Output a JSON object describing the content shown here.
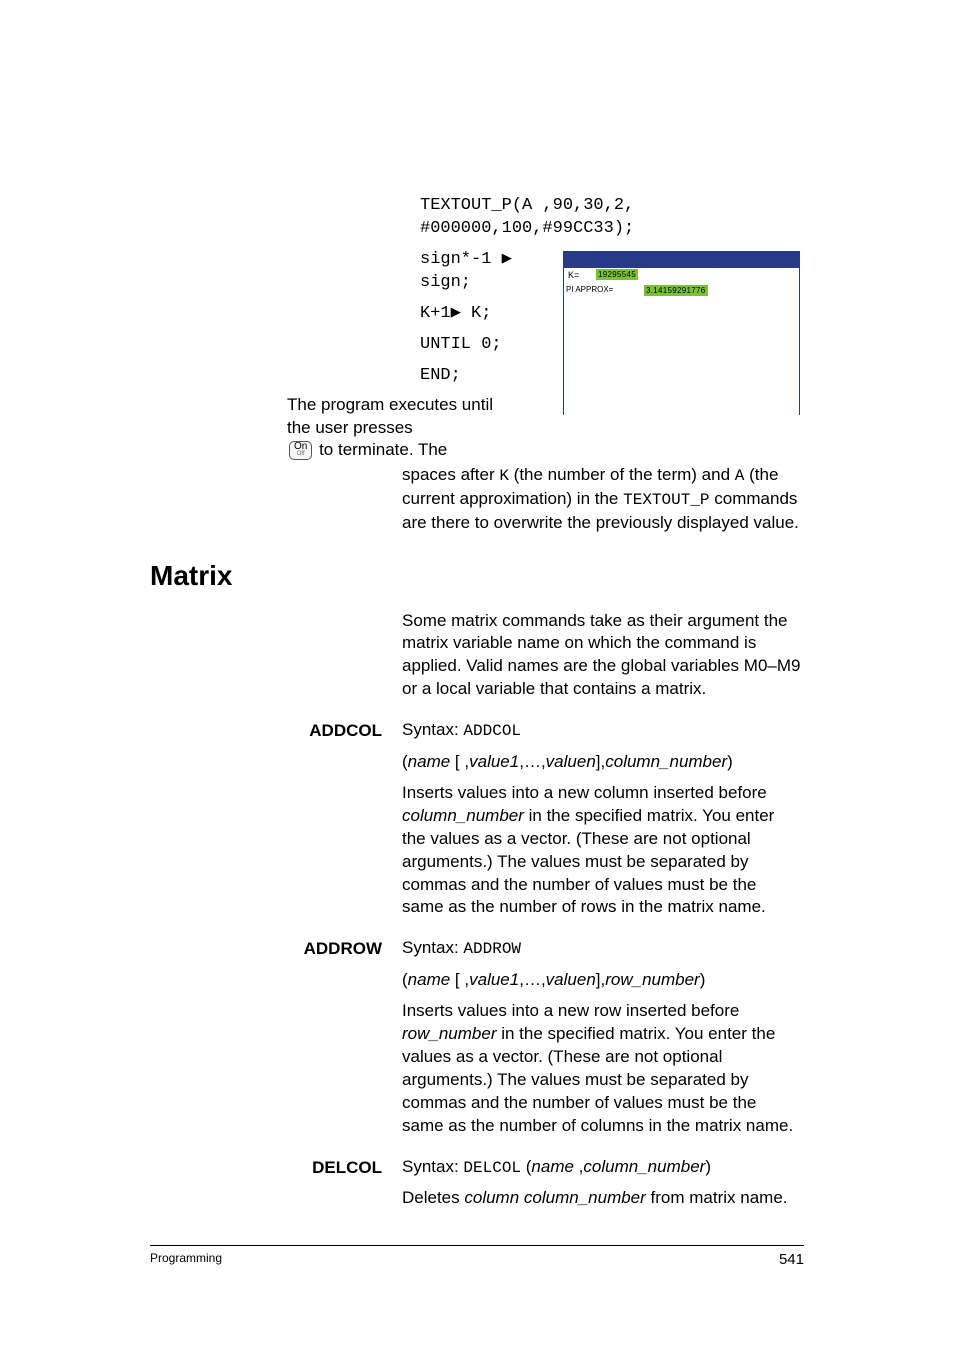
{
  "code": {
    "l1": "TEXTOUT_P(A ,90,30,2,",
    "l2": "#000000,100,#99CC33);",
    "l3a": "sign*-1 ",
    "l3b": "sign;",
    "l4a": "K+1",
    "l4b": " K;",
    "l5": "UNTIL 0;",
    "l6": "END;"
  },
  "triangle": "▶",
  "exec_text_a": "The program executes until the user presses ",
  "on_key_top": "On",
  "on_key_bottom": "Off",
  "exec_text_b": " to terminate. The spaces after ",
  "k_mono": "K",
  "exec_text_c": " (the number of the term) and ",
  "a_mono": "A",
  "exec_text_d": " (the current approximation) in the ",
  "textout_mono": "TEXTOUT_P",
  "exec_text_e": " commands are there to overwrite the previously displayed value.",
  "matrix_heading": "Matrix",
  "matrix_intro": "Some matrix commands take as their argument the matrix variable name on which the command is applied. Valid names are the global variables M0–M9 or a local variable that contains a matrix.",
  "addcol": {
    "label": "ADDCOL",
    "syntax_label": "Syntax: ",
    "syntax_code": "ADDCOL",
    "args_open": "(",
    "args_name": "name",
    "args_mid1": " [ ,",
    "args_v1": "value1",
    "args_dots": ",…,",
    "args_vn": "valuen",
    "args_close1": "],",
    "args_col": "column_number",
    "args_close2": ")",
    "desc_a": "Inserts values into a new column inserted before ",
    "desc_col_it": "column_number",
    "desc_b": " in the specified matrix. You enter the values as a vector. (These are not optional arguments.) The values must be separated by commas and the number of values must be the same as the number of rows in the matrix name."
  },
  "addrow": {
    "label": "ADDROW",
    "syntax_label": "Syntax: ",
    "syntax_code": "ADDROW",
    "args_open": "(",
    "args_name": "name",
    "args_mid1": " [ ,",
    "args_v1": "value1",
    "args_dots": ",…,",
    "args_vn": "valuen",
    "args_close1": "],",
    "args_row": "row_number",
    "args_close2": ")",
    "desc_a": "Inserts values into a new row inserted before ",
    "desc_row_it": "row_number",
    "desc_b": " in the specified matrix. You enter the values as a vector. (These are not optional arguments.) The values must be separated by commas and the number of values must be the same as the number of columns in the matrix name."
  },
  "delcol": {
    "label": "DELCOL",
    "syntax_label": "Syntax: ",
    "syntax_code": "DELCOL",
    "args_open": " (",
    "args_name": "name",
    "args_sep": " ,",
    "args_col": "column_number",
    "args_close": ")",
    "desc_a": "Deletes ",
    "desc_col_it": "column column_number",
    "desc_b": " from matrix name."
  },
  "calc": {
    "k_label": "K=",
    "k_value": "19295545",
    "pi_label": "PI APPROX=",
    "pi_value": "3.14159291776"
  },
  "footer_left": "Programming",
  "footer_right": "541"
}
